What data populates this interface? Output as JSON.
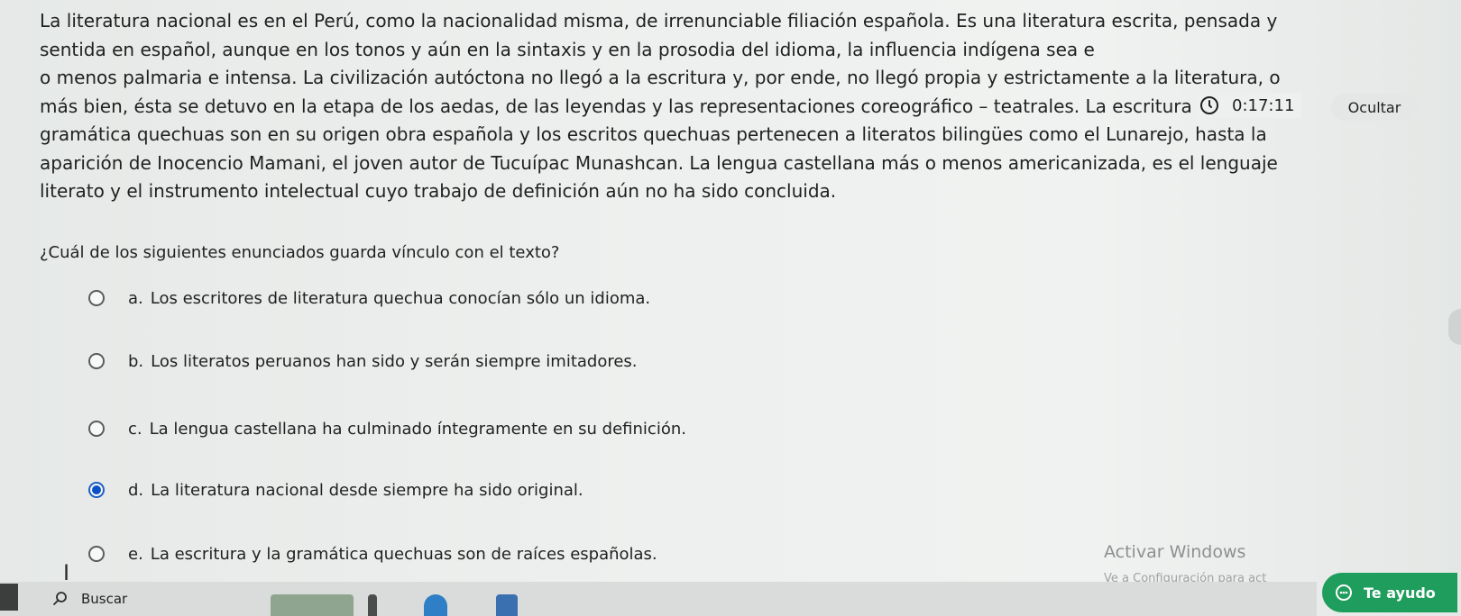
{
  "passage_lines": [
    "La literatura nacional es en el Perú, como la nacionalidad misma, de irrenunciable filiación española. Es una literatura escrita, pensada y",
    "sentida en español, aunque en los tonos y aún en la sintaxis y en la prosodia del idioma, la influencia indígena sea e",
    "o menos palmaria e intensa. La civilización autóctona no llegó a la escritura y, por ende, no llegó propia y estrictamente a la literatura, o",
    "más bien, ésta se detuvo en la etapa de los aedas, de las leyendas y las representaciones coreográfico – teatrales. La escritura y la",
    "gramática quechuas son en su origen obra española y los escritos quechuas pertenecen a literatos bilingües como el Lunarejo, hasta la",
    "aparición de Inocencio Mamani, el joven autor de Tucuípac Munashcan. La lengua castellana más o menos americanizada, es el lenguaje",
    "literato y el instrumento intelectual cuyo trabajo de definición aún no ha sido concluida."
  ],
  "question": "¿Cuál de los siguientes enunciados guarda vínculo con el texto?",
  "options": [
    {
      "letter": "a.",
      "text": "Los escritores de literatura quechua conocían sólo un idioma.",
      "selected": false
    },
    {
      "letter": "b.",
      "text": "Los literatos peruanos han sido y serán siempre imitadores.",
      "selected": false
    },
    {
      "letter": "c.",
      "text": "La lengua castellana ha culminado íntegramente en su definición.",
      "selected": false
    },
    {
      "letter": "d.",
      "text": "La literatura nacional desde siempre ha sido original.",
      "selected": true
    },
    {
      "letter": "e.",
      "text": "La escritura y la gramática quechuas son de raíces españolas.",
      "selected": false
    }
  ],
  "timer": {
    "value": "0:17:11",
    "icon": "clock-icon"
  },
  "hide_button": {
    "label": "Ocultar"
  },
  "watermark": {
    "title": "Activar Windows",
    "subtitle": "Ve a Configuración para act"
  },
  "help_button": {
    "label": "Te ayudo",
    "icon": "chat-icon",
    "color": "#1f9d5c"
  },
  "taskbar": {
    "search_label": "Buscar",
    "search_icon": "search-icon"
  },
  "colors": {
    "radio_selected": "#0b4fc9",
    "background": "#eceeed",
    "text": "#1f2120"
  }
}
